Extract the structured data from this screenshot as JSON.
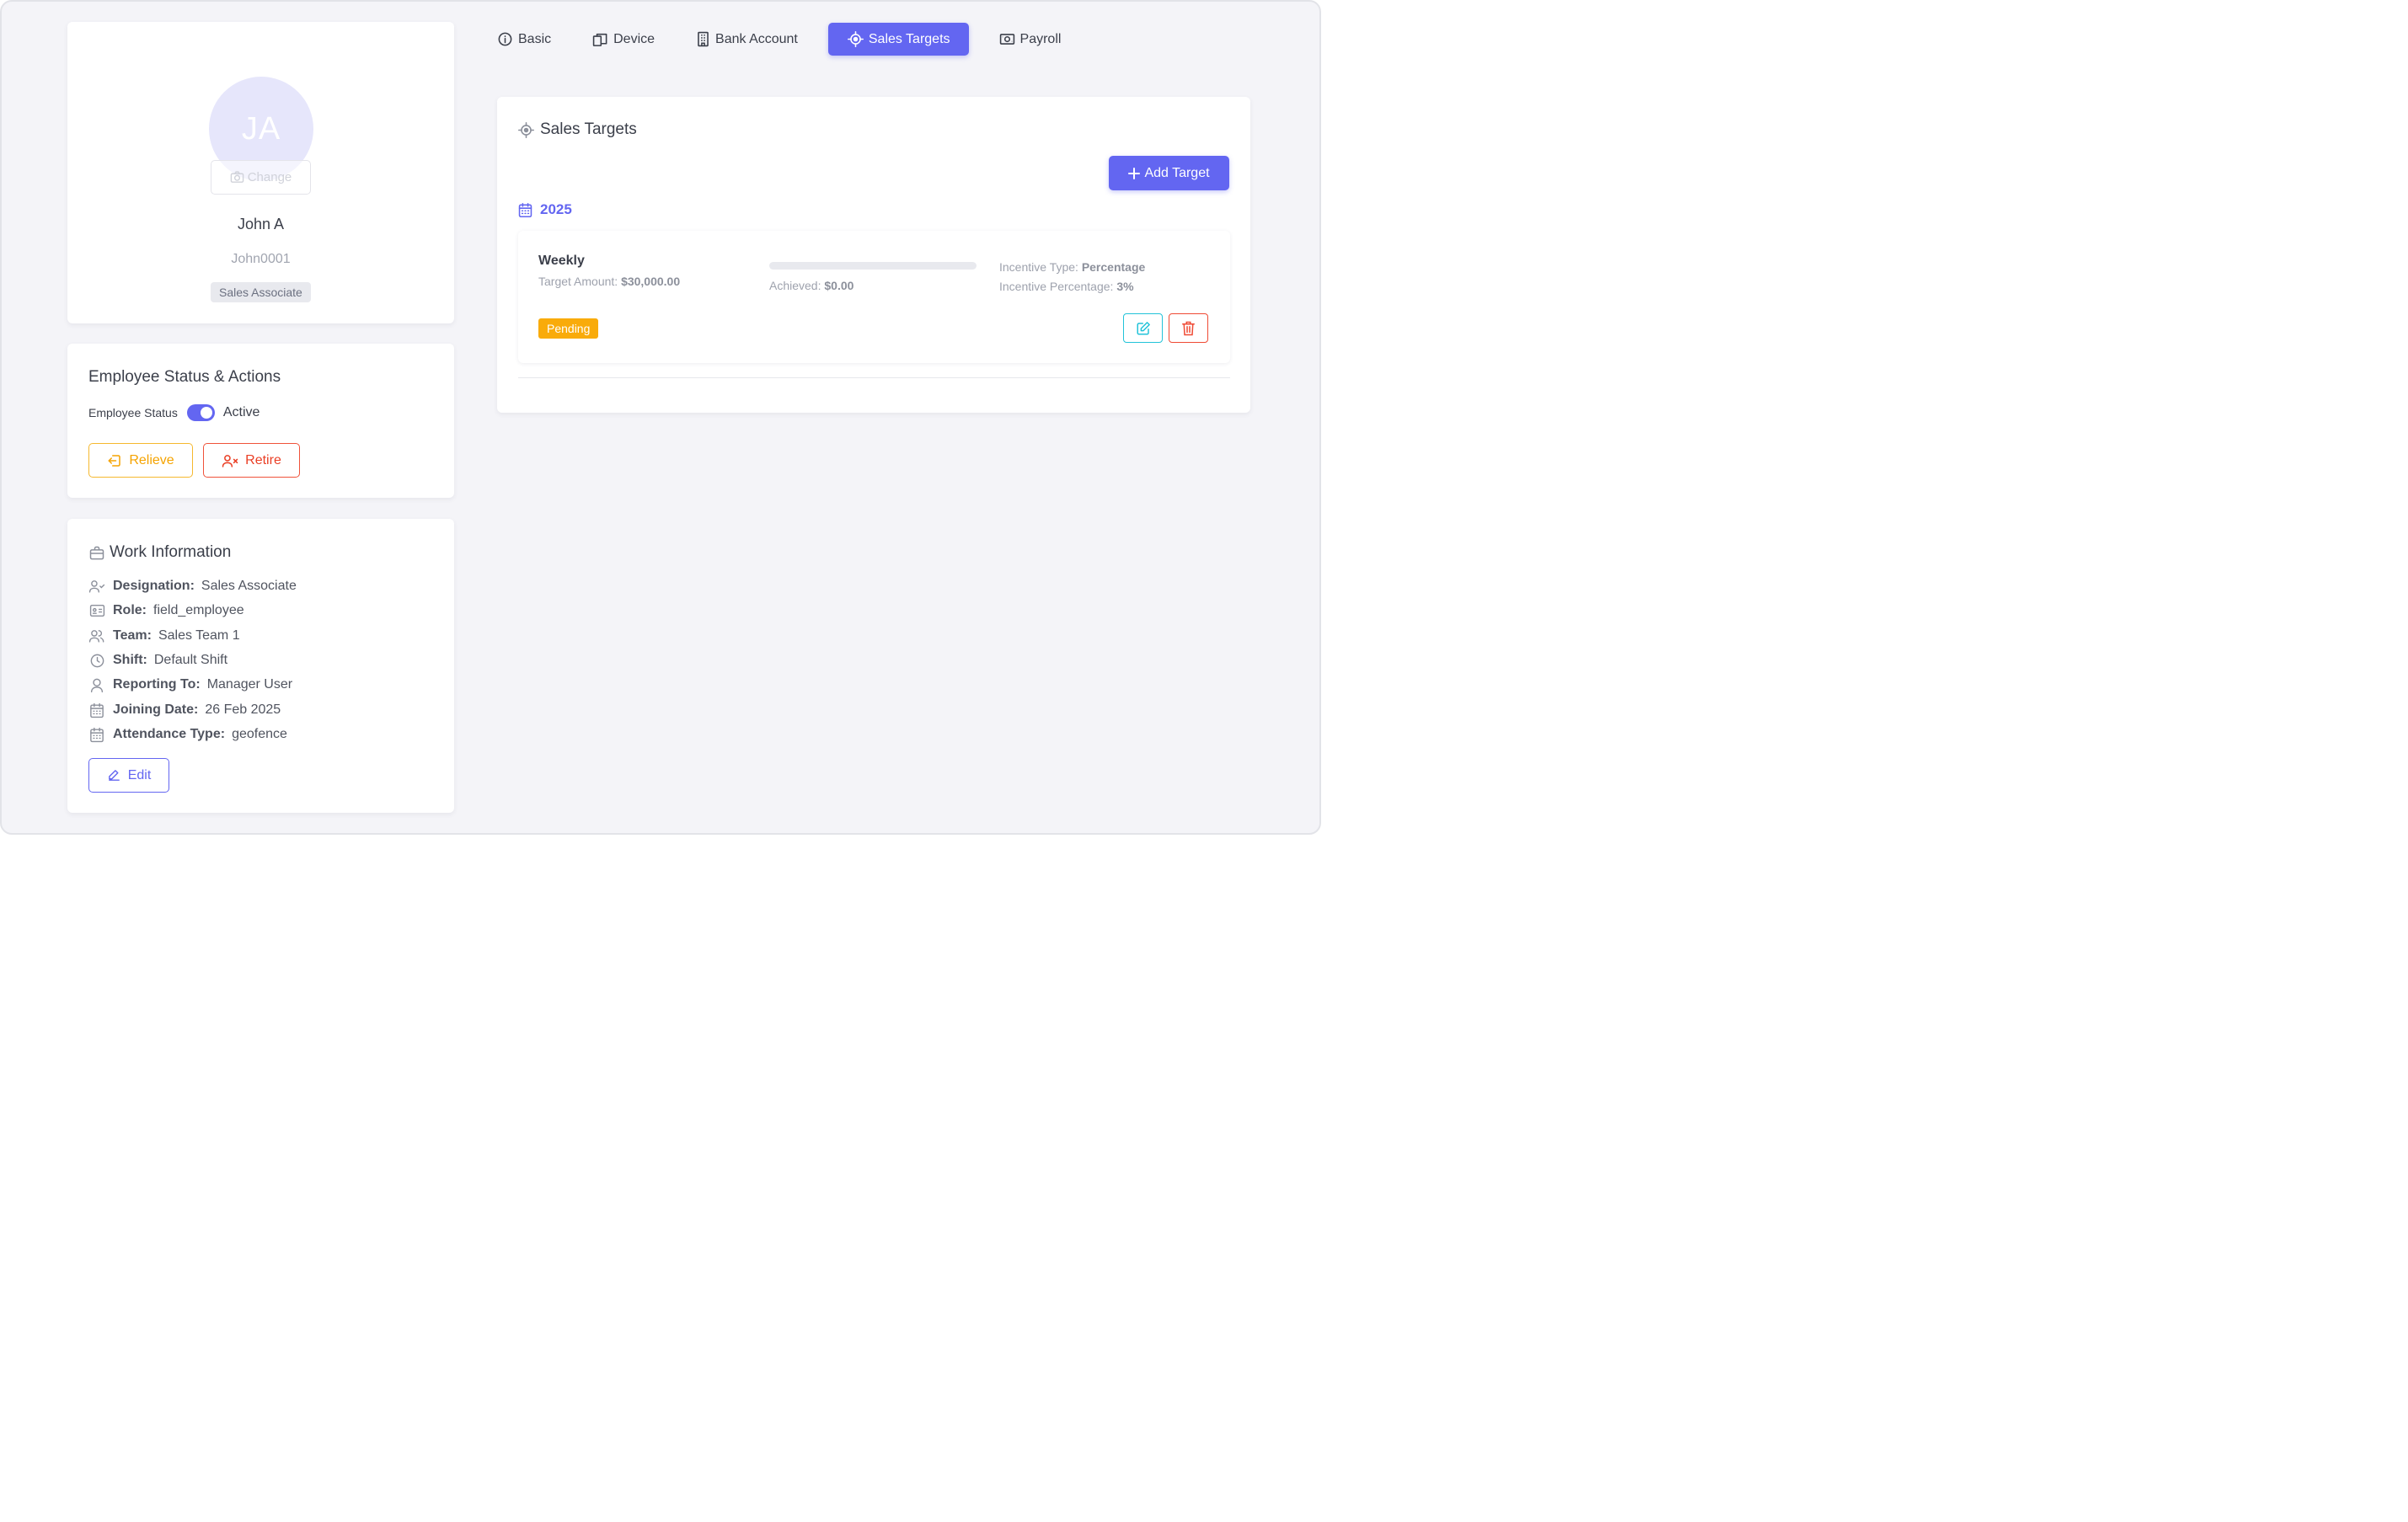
{
  "profile": {
    "initials": "JA",
    "change_label": "Change",
    "name": "John A",
    "code": "John0001",
    "designation_badge": "Sales Associate"
  },
  "status_card": {
    "title": "Employee Status & Actions",
    "status_label": "Employee Status",
    "status_on": true,
    "status_value": "Active",
    "relieve_label": "Relieve",
    "retire_label": "Retire"
  },
  "work": {
    "title": "Work Information",
    "rows": [
      {
        "key": "Designation:",
        "value": "Sales Associate",
        "icon": "user-check-icon"
      },
      {
        "key": "Role:",
        "value": "field_employee",
        "icon": "id-card-icon"
      },
      {
        "key": "Team:",
        "value": "Sales Team 1",
        "icon": "users-icon"
      },
      {
        "key": "Shift:",
        "value": "Default Shift",
        "icon": "clock-icon"
      },
      {
        "key": "Reporting To:",
        "value": "Manager User",
        "icon": "user-icon"
      },
      {
        "key": "Joining Date:",
        "value": "26 Feb 2025",
        "icon": "calendar-icon"
      },
      {
        "key": "Attendance Type:",
        "value": "geofence",
        "icon": "calendar-icon"
      }
    ],
    "edit_label": "Edit"
  },
  "tabs": [
    {
      "label": "Basic",
      "icon": "info-icon"
    },
    {
      "label": "Device",
      "icon": "device-icon"
    },
    {
      "label": "Bank Account",
      "icon": "building-icon"
    },
    {
      "label": "Sales Targets",
      "icon": "target-icon",
      "active": true
    },
    {
      "label": "Payroll",
      "icon": "cash-icon"
    }
  ],
  "sales": {
    "title": "Sales Targets",
    "add_label": "Add Target",
    "year": "2025",
    "target": {
      "period": "Weekly",
      "amount_label": "Target Amount:",
      "amount_value": "$30,000.00",
      "progress": 0,
      "achieved_label": "Achieved:",
      "achieved_value": "$0.00",
      "incentive_type_label": "Incentive Type:",
      "incentive_type_value": "Percentage",
      "incentive_pct_label": "Incentive Percentage:",
      "incentive_pct_value": "3%",
      "status": "Pending"
    }
  },
  "colors": {
    "accent": "#6366f1",
    "warning": "#f9ab0a",
    "danger": "#ef4a34",
    "info": "#22c3d9"
  }
}
